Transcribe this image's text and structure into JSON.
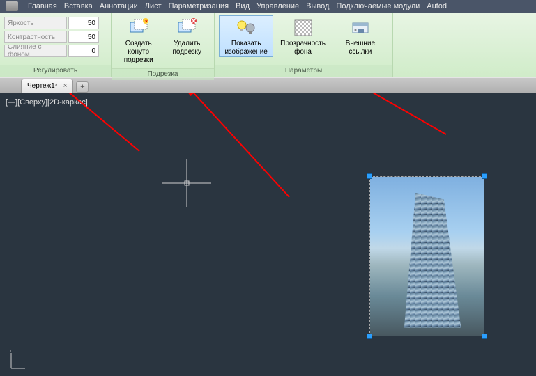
{
  "menubar": {
    "items": [
      "Главная",
      "Вставка",
      "Аннотации",
      "Лист",
      "Параметризация",
      "Вид",
      "Управление",
      "Вывод",
      "Подключаемые модули",
      "Autod"
    ]
  },
  "ribbon": {
    "panels": {
      "adjust": {
        "label": "Регулировать",
        "brightness_label": "Яркость",
        "brightness_value": "50",
        "contrast_label": "Контрастность",
        "contrast_value": "50",
        "fade_label": "Слияние с фоном",
        "fade_value": "0"
      },
      "clip": {
        "label": "Подрезка",
        "create_clip": "Создать конутр\nподрезки",
        "delete_clip": "Удалить\nподрезку"
      },
      "options": {
        "label": "Параметры",
        "show_image": "Показать\nизображение",
        "bg_transparency": "Прозрачность\nфона",
        "xrefs": "Внешние ссылки"
      }
    }
  },
  "tabs": {
    "active": "Чертеж1*"
  },
  "canvas": {
    "view_label": "[—][Сверху][2D-каркас]",
    "ucs_label": "Y"
  }
}
